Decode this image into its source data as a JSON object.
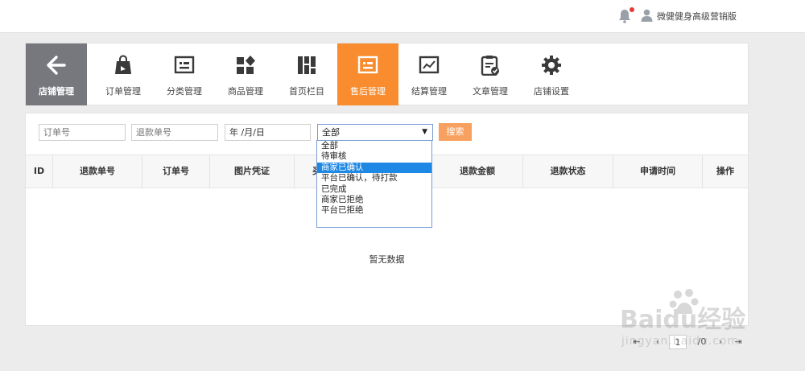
{
  "header": {
    "user_name": "微健健身高级营销版"
  },
  "nav": {
    "items": [
      {
        "label": "店铺管理",
        "icon": "arrow-left-icon"
      },
      {
        "label": "订单管理",
        "icon": "shopping-bag-icon"
      },
      {
        "label": "分类管理",
        "icon": "category-icon"
      },
      {
        "label": "商品管理",
        "icon": "products-icon"
      },
      {
        "label": "首页栏目",
        "icon": "columns-icon"
      },
      {
        "label": "售后管理",
        "icon": "after-sales-icon"
      },
      {
        "label": "结算管理",
        "icon": "settlement-icon"
      },
      {
        "label": "文章管理",
        "icon": "article-icon"
      },
      {
        "label": "店铺设置",
        "icon": "gear-icon"
      }
    ]
  },
  "filters": {
    "order_placeholder": "订单号",
    "refund_placeholder": "退款单号",
    "date_value": "年 /月/日",
    "status_selected": "全部",
    "search_label": "搜索"
  },
  "dropdown": {
    "options": [
      "全部",
      "待审核",
      "商家已确认",
      "平台已确认，待打款",
      "已完成",
      "商家已拒绝",
      "平台已拒绝"
    ],
    "highlighted": "商家已确认"
  },
  "table": {
    "headers": [
      "ID",
      "退款单号",
      "订单号",
      "图片凭证",
      "买",
      "退款金额",
      "退款状态",
      "申请时间",
      "操作"
    ],
    "empty_text": "暂无数据"
  },
  "pager": {
    "current_page": "1",
    "total": "/0"
  },
  "watermark": {
    "logo_text": "Baidu经验",
    "url_text": "jingyan.baidu.com"
  },
  "colors": {
    "accent": "#f88c2e",
    "nav_back": "#76787e",
    "highlight": "#1e88e5",
    "notification_dot": "#e53935"
  }
}
